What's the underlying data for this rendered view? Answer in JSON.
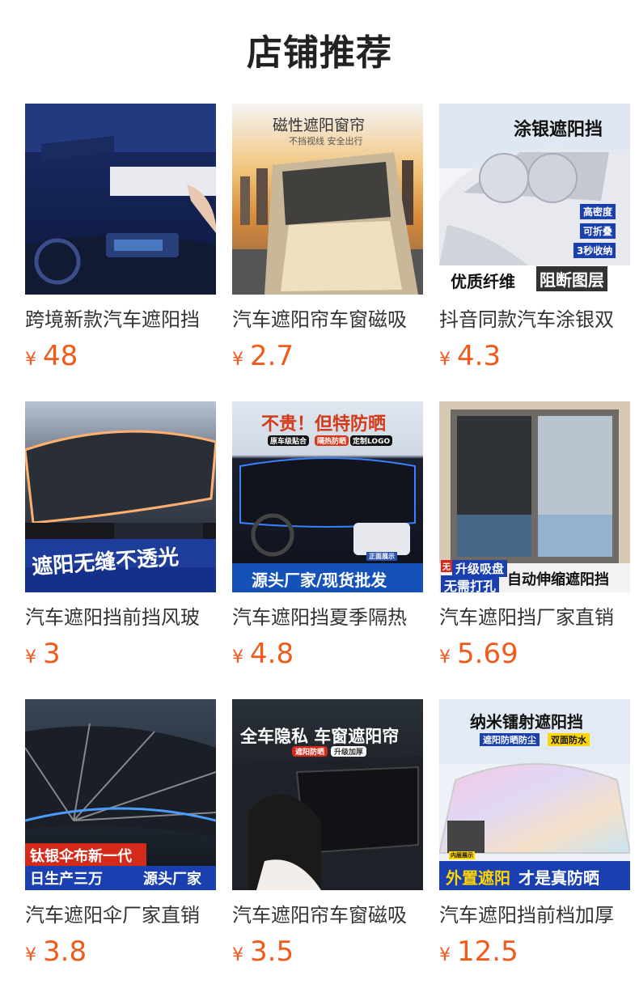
{
  "header": {
    "title": "店铺推荐"
  },
  "currency": "¥",
  "products": [
    {
      "title": "跨境新款汽车遮阳挡",
      "price": "48",
      "overlays": [],
      "icon": "car-interior-sunshade-image"
    },
    {
      "title": "汽车遮阳帘车窗磁吸",
      "price": "2.7",
      "overlays": [
        "磁性遮阳窗帘",
        "不挡视线 安全出行"
      ],
      "icon": "magnetic-window-curtain-image"
    },
    {
      "title": "抖音同款汽车涂银双",
      "price": "4.3",
      "overlays": [
        "涂银遮阳挡",
        "高密度",
        "可折叠",
        "3秒收纳",
        "优质纤维",
        "阻断图层"
      ],
      "icon": "silver-windshield-shade-image"
    },
    {
      "title": "汽车遮阳挡前挡风玻",
      "price": "3",
      "overlays": [
        "遮阳无缝不透光"
      ],
      "icon": "umbrella-shade-image"
    },
    {
      "title": "汽车遮阳挡夏季隔热",
      "price": "4.8",
      "overlays": [
        "不贵！但特防晒",
        "原车级贴合",
        "隔热防晒",
        "定制LOGO",
        "正面展示",
        "源头厂家/现货批发"
      ],
      "icon": "windshield-shade-image"
    },
    {
      "title": "汽车遮阳挡厂家直销",
      "price": "5.69",
      "overlays": [
        "升级吸盘",
        "无需打孔",
        "自动伸缩遮阳挡",
        "无"
      ],
      "icon": "retractable-window-shade-image"
    },
    {
      "title": "汽车遮阳伞厂家直销",
      "price": "3.8",
      "overlays": [
        "钛银伞布新一代",
        "日生产三万",
        "源头厂家"
      ],
      "icon": "car-umbrella-image"
    },
    {
      "title": "汽车遮阳帘车窗磁吸",
      "price": "3.5",
      "overlays": [
        "全车隐私 车窗遮阳帘",
        "遮阳防晒",
        "升级加厚"
      ],
      "icon": "privacy-window-curtain-image"
    },
    {
      "title": "汽车遮阳挡前档加厚",
      "price": "12.5",
      "overlays": [
        "纳米镭射遮阳挡",
        "遮阳防晒防尘",
        "双面防水",
        "外置遮阳",
        "才是真防晒",
        "内层展示"
      ],
      "icon": "laser-shade-cover-image"
    }
  ]
}
